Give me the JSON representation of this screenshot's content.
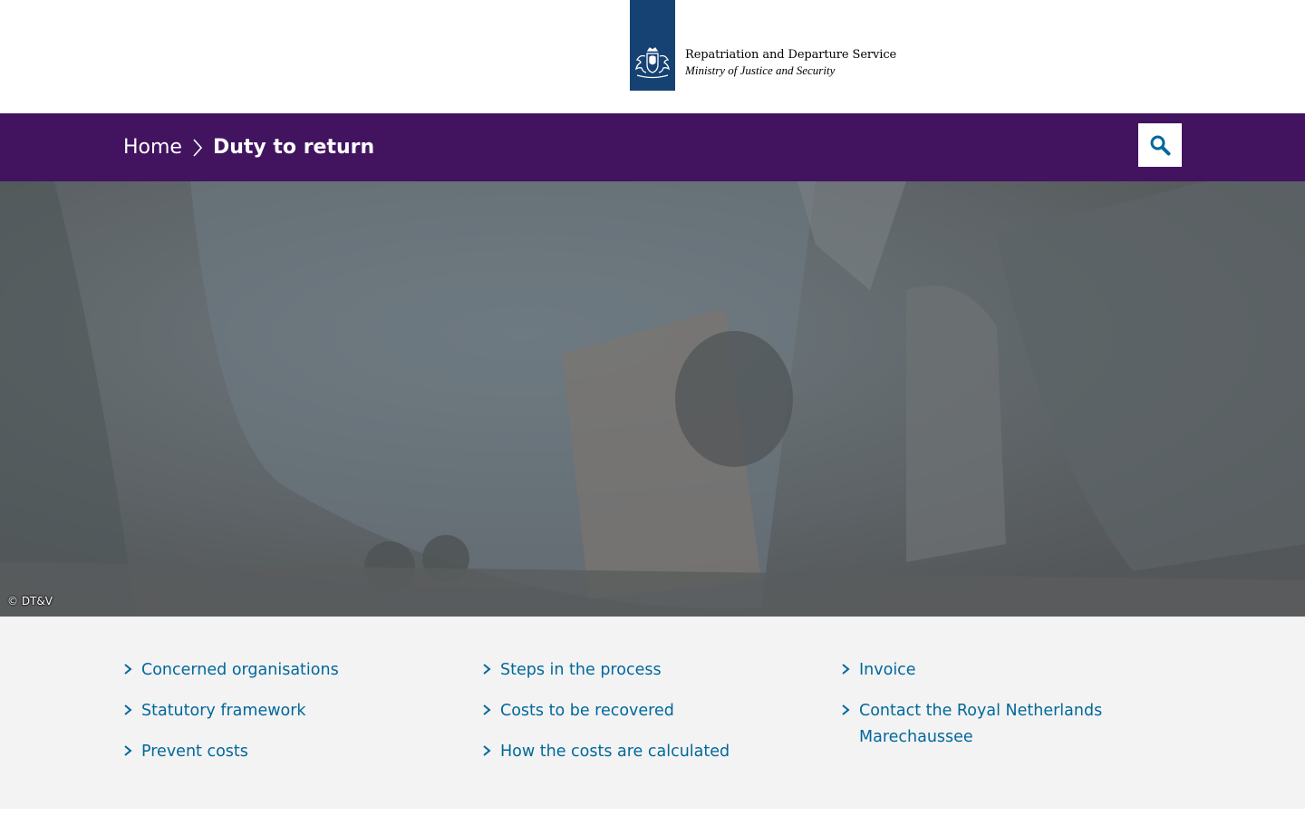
{
  "header": {
    "logo_title": "Repatriation and Departure Service",
    "logo_subtitle": "Ministry of Justice and Security",
    "brand_color": "#154273"
  },
  "breadcrumb": {
    "home": "Home",
    "current": "Duty to return",
    "bar_color": "#42145f"
  },
  "search": {
    "icon": "search-icon"
  },
  "hero": {
    "credit": "© DT&V"
  },
  "links": {
    "color": "#01689b",
    "columns": [
      {
        "items": [
          "Concerned organisations",
          "Statutory framework",
          "Prevent costs"
        ]
      },
      {
        "items": [
          "Steps in the process",
          "Costs to be recovered",
          "How the costs are calculated"
        ]
      },
      {
        "items": [
          "Invoice",
          "Contact the Royal Netherlands Marechaussee"
        ]
      }
    ]
  }
}
